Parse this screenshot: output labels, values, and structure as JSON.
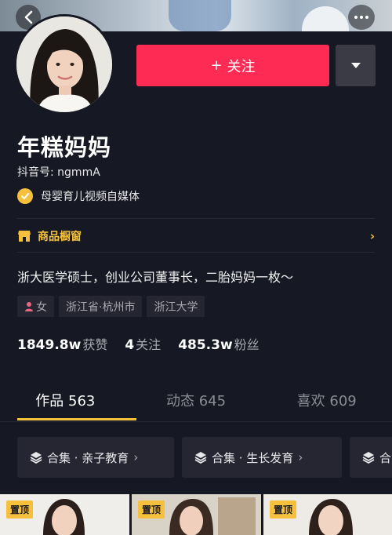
{
  "profile": {
    "name": "年糕妈妈",
    "uid_label": "抖音号: ngmmA",
    "verification": "母婴育儿视频自媒体",
    "shop_label": "商品橱窗",
    "bio": "浙大医学硕士，创业公司董事长，二胎妈妈一枚～",
    "tags": [
      "女",
      "浙江省·杭州市",
      "浙江大学"
    ]
  },
  "actions": {
    "follow_label": "关注",
    "follow_prefix": "+"
  },
  "stats": [
    {
      "value": "1849.8w",
      "label": "获赞"
    },
    {
      "value": "4",
      "label": "关注"
    },
    {
      "value": "485.3w",
      "label": "粉丝"
    }
  ],
  "tabs": [
    {
      "label": "作品 563"
    },
    {
      "label": "动态 645"
    },
    {
      "label": "喜欢 609"
    }
  ],
  "collections": [
    {
      "label": "合集 · 亲子教育"
    },
    {
      "label": "合集 · 生长发育"
    },
    {
      "label": "合"
    }
  ],
  "pinned_label": "置顶",
  "colors": {
    "background": "#161823",
    "accent_red": "#fe2c55",
    "accent_yellow": "#f5c13d",
    "chip_bg": "#252632"
  }
}
